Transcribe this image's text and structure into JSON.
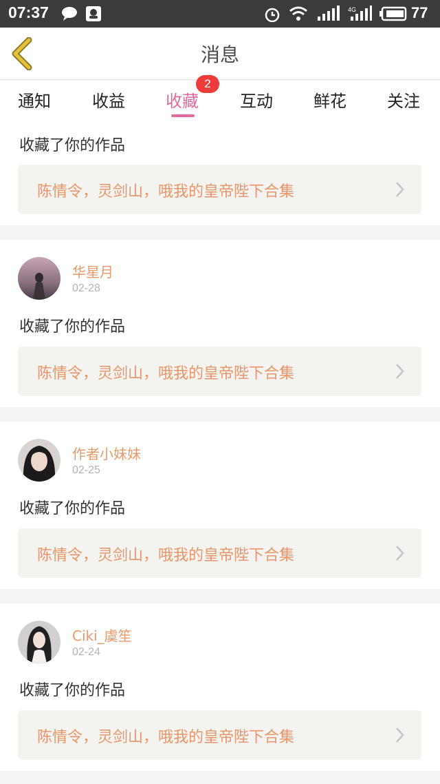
{
  "status_bar": {
    "time": "07:37",
    "battery": "77",
    "icons": [
      "chat-bubble-icon",
      "qq-icon",
      "alarm-icon",
      "wifi-icon",
      "signal-icon",
      "4g-signal-icon",
      "battery-icon"
    ]
  },
  "header": {
    "title": "消息",
    "back_icon": "chevron-left-icon"
  },
  "tabs": [
    {
      "label": "通知"
    },
    {
      "label": "收益"
    },
    {
      "label": "收藏",
      "active": true,
      "badge": "2"
    },
    {
      "label": "互动"
    },
    {
      "label": "鲜花"
    },
    {
      "label": "关注"
    }
  ],
  "messages": [
    {
      "user": "",
      "date": "",
      "action": "收藏了你的作品",
      "work": "陈情令，灵剑山，哦我的皇帝陛下合集"
    },
    {
      "user": "华星月",
      "date": "02-28",
      "action": "收藏了你的作品",
      "work": "陈情令，灵剑山，哦我的皇帝陛下合集"
    },
    {
      "user": "作者小妹妹",
      "date": "02-25",
      "action": "收藏了你的作品",
      "work": "陈情令，灵剑山，哦我的皇帝陛下合集"
    },
    {
      "user": "Ciki_虞笙",
      "date": "02-24",
      "action": "收藏了你的作品",
      "work": "陈情令，灵剑山，哦我的皇帝陛下合集"
    }
  ],
  "colors": {
    "accent": "#e26aa0",
    "username": "#e79a6a",
    "work_text": "#e8956a",
    "badge": "#ee3b3b",
    "back_icon": "#e6c23a"
  }
}
